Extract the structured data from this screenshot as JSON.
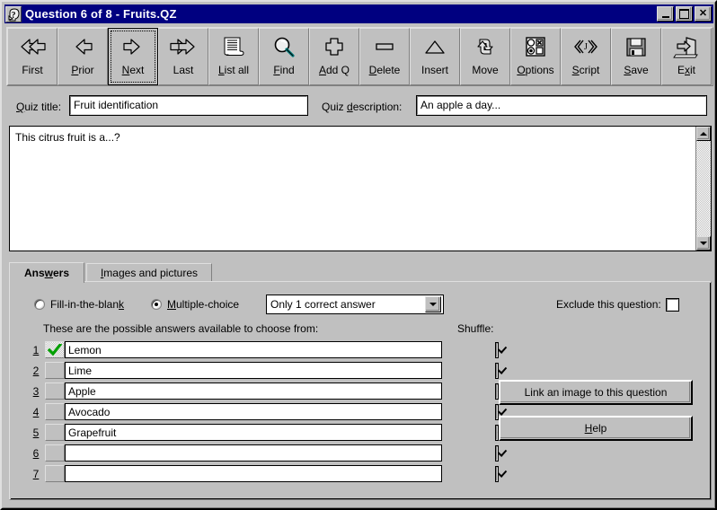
{
  "window": {
    "title": "Question 6 of 8 - Fruits.QZ",
    "icon": "question-head-icon",
    "minimize_label": "_",
    "maximize_label": "□",
    "close_label": "✕"
  },
  "toolbar": {
    "buttons": [
      {
        "label": "First",
        "mnemonic": "",
        "icon": "double-left-arrow-icon",
        "focused": false
      },
      {
        "label": "Prior",
        "mnemonic": "P",
        "icon": "left-arrow-icon",
        "focused": false
      },
      {
        "label": "Next",
        "mnemonic": "N",
        "icon": "right-arrow-icon",
        "focused": true
      },
      {
        "label": "Last",
        "mnemonic": "",
        "icon": "double-right-arrow-icon",
        "focused": false
      },
      {
        "label": "List all",
        "mnemonic": "L",
        "icon": "document-list-icon",
        "focused": false
      },
      {
        "label": "Find",
        "mnemonic": "F",
        "icon": "magnifier-icon",
        "focused": false
      },
      {
        "label": "Add Q",
        "mnemonic": "A",
        "icon": "plus-icon",
        "focused": false
      },
      {
        "label": "Delete",
        "mnemonic": "D",
        "icon": "minus-bar-icon",
        "focused": false
      },
      {
        "label": "Insert",
        "mnemonic": "",
        "icon": "triangle-icon",
        "focused": false
      },
      {
        "label": "Move",
        "mnemonic": "",
        "icon": "circular-arrows-icon",
        "focused": false
      },
      {
        "label": "Options",
        "mnemonic": "O",
        "icon": "options-grid-icon",
        "focused": false
      },
      {
        "label": "Script",
        "mnemonic": "S",
        "icon": "angle-brackets-icon",
        "focused": false
      },
      {
        "label": "Save",
        "mnemonic": "S",
        "icon": "floppy-disk-icon",
        "focused": false
      },
      {
        "label": "Exit",
        "mnemonic": "x",
        "icon": "exit-door-icon",
        "focused": false
      }
    ]
  },
  "fields": {
    "quiz_title_label": "Quiz title:",
    "quiz_title_value": "Fruit identification",
    "quiz_description_label": "Quiz description:",
    "quiz_description_value": "An apple a day..."
  },
  "question": {
    "text": "This citrus fruit is a...?"
  },
  "tabs": [
    {
      "label": "Answers",
      "active": true
    },
    {
      "label": "Images and pictures",
      "active": false
    }
  ],
  "answers_tab": {
    "type_fill_label": "Fill-in-the-blank",
    "type_fill_selected": false,
    "type_multiple_label": "Multiple-choice",
    "type_multiple_selected": true,
    "mode_value": "Only 1 correct answer",
    "exclude_label": "Exclude this question:",
    "exclude_checked": false,
    "list_caption": "These are the possible answers available to choose from:",
    "shuffle_label": "Shuffle:",
    "rows": [
      {
        "num": "1",
        "text": "Lemon",
        "correct": true,
        "shuffle": true
      },
      {
        "num": "2",
        "text": "Lime",
        "correct": false,
        "shuffle": true
      },
      {
        "num": "3",
        "text": "Apple",
        "correct": false,
        "shuffle": true
      },
      {
        "num": "4",
        "text": "Avocado",
        "correct": false,
        "shuffle": true
      },
      {
        "num": "5",
        "text": "Grapefruit",
        "correct": false,
        "shuffle": true
      },
      {
        "num": "6",
        "text": "",
        "correct": false,
        "shuffle": true
      },
      {
        "num": "7",
        "text": "",
        "correct": false,
        "shuffle": true
      }
    ],
    "link_image_label": "Link an image to this question",
    "help_label": "Help"
  },
  "colors": {
    "face": "#c0c0c0",
    "titlebar": "#000080",
    "correct_check": "#00a000"
  }
}
